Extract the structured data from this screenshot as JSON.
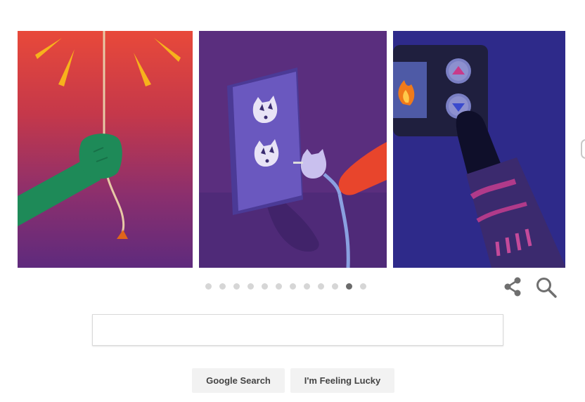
{
  "doodle": {
    "slides_count": 12,
    "active_slide": 11,
    "colors": {
      "panel1_top": "#e8493a",
      "panel1_bottom": "#6a2a80",
      "panel2_bg": "#5a2e7e",
      "panel3_bg": "#2e2a8a",
      "arm_green": "#1e8a58",
      "ray_yellow": "#f7b21c",
      "outlet_plate": "#5f4fb0",
      "red_arm": "#e8452c",
      "dark_finger": "#0f0f2a"
    }
  },
  "carousel_dots": [
    {
      "state": "inactive"
    },
    {
      "state": "inactive"
    },
    {
      "state": "inactive"
    },
    {
      "state": "inactive"
    },
    {
      "state": "inactive"
    },
    {
      "state": "inactive"
    },
    {
      "state": "inactive"
    },
    {
      "state": "inactive"
    },
    {
      "state": "inactive"
    },
    {
      "state": "inactive"
    },
    {
      "state": "active"
    },
    {
      "state": "inactive"
    }
  ],
  "icons": {
    "share": "share-icon",
    "search": "magnifier-icon"
  },
  "search": {
    "value": "",
    "placeholder": ""
  },
  "buttons": {
    "google_search": "Google Search",
    "feeling_lucky": "I'm Feeling Lucky"
  }
}
